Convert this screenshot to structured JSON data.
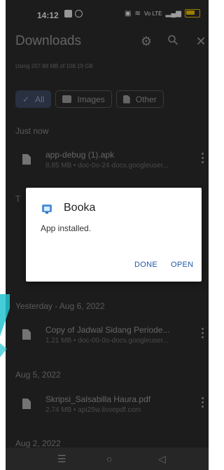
{
  "status_bar": {
    "time": "14:12",
    "signal_text": "Vo LTE"
  },
  "app_bar": {
    "title": "Downloads",
    "icons": [
      "settings-icon",
      "search-icon",
      "close-icon"
    ]
  },
  "storage_text": "Using 207.88 MB of 108.19 GB",
  "filters": [
    {
      "label": "All",
      "selected": true,
      "icon": "check-icon"
    },
    {
      "label": "Images",
      "selected": false,
      "icon": "image-icon"
    },
    {
      "label": "Other",
      "selected": false,
      "icon": "document-icon"
    }
  ],
  "sections": {
    "just_now": "Just now",
    "partially_hidden": "T",
    "yesterday": "Yesterday - Aug 6, 2022",
    "aug5": "Aug 5, 2022",
    "aug2": "Aug 2, 2022"
  },
  "downloads": [
    {
      "name": "app-debug (1).apk",
      "meta": "8.85 MB • doc-0o-24-docs.googleuser..."
    },
    {
      "name": "Copy of Jadwal Sidang Periode...",
      "meta": "1.21 MB • doc-00-0o-docs.googleuser..."
    },
    {
      "name": "Skripsi_Salsabilla Haura.pdf",
      "meta": "2.74 MB • api25w.ilovepdf.com"
    }
  ],
  "dialog": {
    "app_name": "Booka",
    "message": "App installed.",
    "done_label": "DONE",
    "open_label": "OPEN"
  },
  "colors": {
    "background": "#2c2c2c",
    "dialog": "#ffffff",
    "dialog_button": "#1f5aa8",
    "accent": "#25c4d0"
  }
}
